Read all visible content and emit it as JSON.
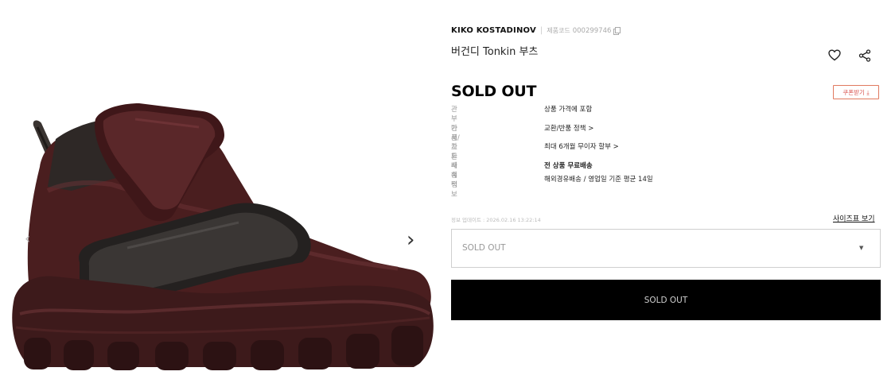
{
  "gallery": {
    "image_alt": "burgundy high-top boot with velcro straps",
    "prev_icon": "chevron-left-icon",
    "next_icon": "chevron-right-icon"
  },
  "product": {
    "brand": "KIKO KOSTADINOV",
    "code_label": "제품코드",
    "code": "000299746",
    "name": "버건디 Tonkin 부츠",
    "status": "SOLD OUT"
  },
  "actions": {
    "wishlist_icon": "heart-icon",
    "share_icon": "share-icon",
    "coupon_label": "쿠폰받기 ⤓"
  },
  "specs": [
    {
      "label": "관부가세",
      "value": "상품 가격에 포함"
    },
    {
      "label": "반품/교환",
      "value": "교환/반품 정책 >"
    },
    {
      "label": "카드사 혜택",
      "value": "최대 6개월 무이자 할부 >"
    },
    {
      "label": "배송정보",
      "value": "전 상품 무료배송",
      "value2": "해외경유배송 / 영업일 기준 평균 14일"
    }
  ],
  "updated": "정보 업데이트 : 2026.02.16 13:22:14",
  "size_guide": "사이즈표 보기",
  "select": {
    "value": "SOLD OUT"
  },
  "buy_button": "SOLD OUT",
  "colors": {
    "boot_leather": "#4a1e1f",
    "boot_dark": "#2b2522",
    "coupon_accent": "#d9534f"
  }
}
